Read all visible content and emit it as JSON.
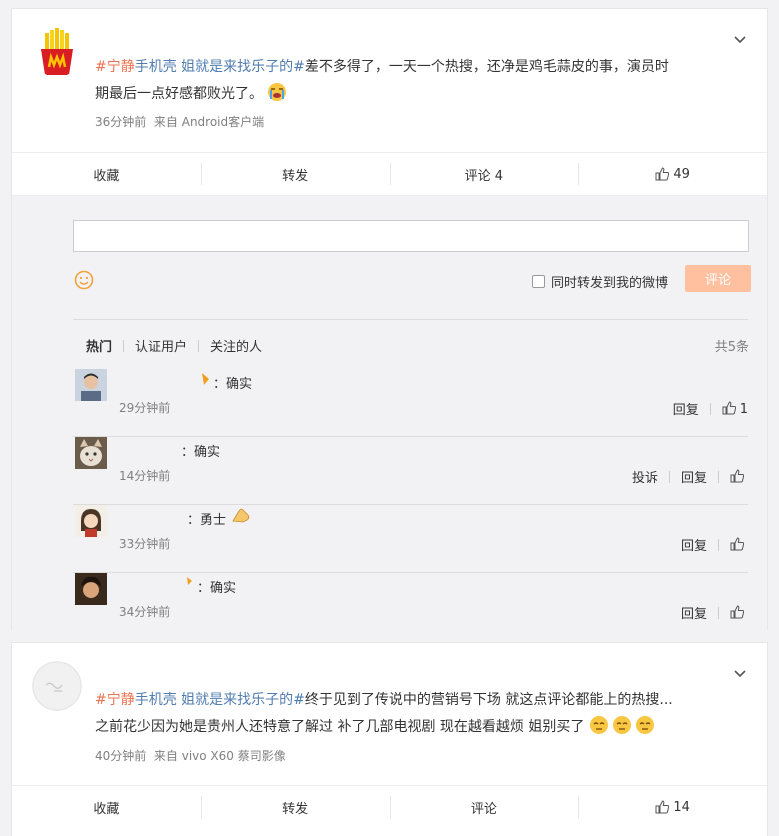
{
  "post1": {
    "topics": [
      "#宁静手机壳 姐就是来找乐子的#"
    ],
    "topic_part1": "#宁静",
    "topic_part2": "手机壳 姐就是来找乐子的#",
    "text_line1": "差不多得了，一天一个热搜，还净是鸡毛蒜皮的事，演员时",
    "text_line2": "期最后一点好感都败光了。",
    "time": "36分钟前",
    "source": "来自 Android客户端",
    "avatar_icon": "mcdonalds-fries-avatar",
    "actions": {
      "favorite": "收藏",
      "repost": "转发",
      "comment": "评论 4",
      "like": "49"
    }
  },
  "comment_box": {
    "forward_label": "同时转发到我的微博",
    "submit_label": "评论",
    "tabs": [
      "热门",
      "认证用户",
      "关注的人"
    ],
    "total": "共5条"
  },
  "comments": [
    {
      "text": "：确实",
      "time": "29分钟前",
      "ops": [
        "回复"
      ],
      "like": "1"
    },
    {
      "text": "：确实",
      "time": "14分钟前",
      "ops": [
        "投诉",
        "回复"
      ],
      "like": ""
    },
    {
      "text": "：勇士",
      "time": "33分钟前",
      "ops": [
        "回复"
      ],
      "like": ""
    },
    {
      "text": "：确实",
      "time": "34分钟前",
      "ops": [
        "回复"
      ],
      "like": ""
    }
  ],
  "post2": {
    "topic_part1": "#宁静",
    "topic_part2": "手机壳 姐就是来找乐子的#",
    "text_line1": "终于见到了传说中的营销号下场 就这点评论都能上的热搜...",
    "text_line2": "之前花少因为她是贵州人还特意了解过 补了几部电视剧 现在越看越烦 姐别买了",
    "time": "40分钟前",
    "source": "来自 vivo X60 蔡司影像",
    "actions": {
      "favorite": "收藏",
      "repost": "转发",
      "comment": "评论",
      "like": "14"
    }
  },
  "colors": {
    "accent": "#eb7350",
    "link": "#507daf",
    "button": "#ffc09f"
  }
}
